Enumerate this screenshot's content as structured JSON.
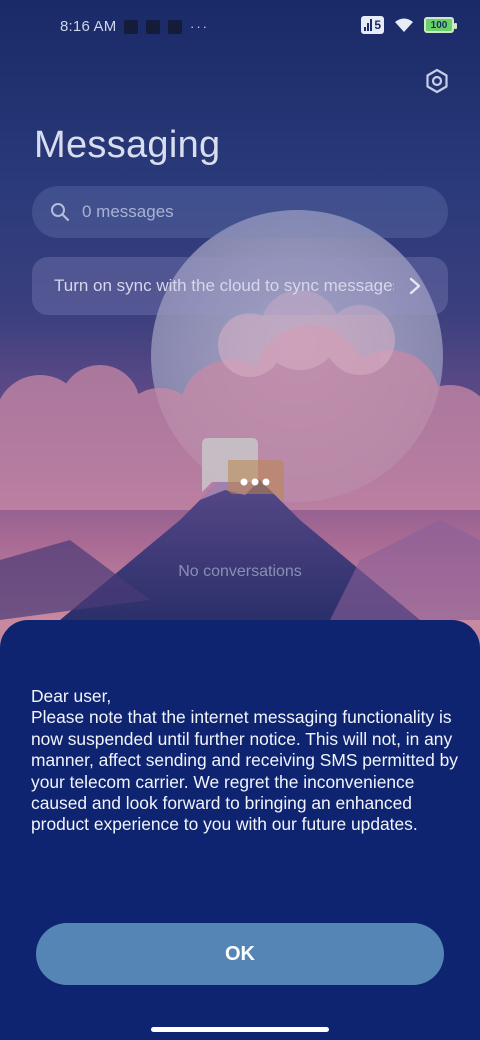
{
  "status_bar": {
    "time": "8:16 AM",
    "more_indicator": "···",
    "sim_slot": "5",
    "battery_level": "100"
  },
  "header": {
    "title": "Messaging",
    "settings_icon": "gear-icon"
  },
  "search": {
    "placeholder": "0 messages",
    "icon": "search-icon"
  },
  "sync_banner": {
    "text": "Turn on sync with the cloud to sync messages",
    "icon": "chevron-right-icon"
  },
  "empty_state": {
    "icon": "chat-bubbles-icon",
    "text": "No conversations"
  },
  "notice_sheet": {
    "message": "Dear user,\nPlease note that the internet messaging functionality is now suspended until further notice. This will not, in any manner, affect sending and receiving SMS permitted by your telecom carrier. We regret the inconvenience caused and look forward to bringing an enhanced product experience to you with our future updates.",
    "ok_label": "OK"
  },
  "colors": {
    "sheet_background": "#0e2470",
    "ok_button": "#5585b5",
    "text_primary": "#f2f4fb"
  }
}
